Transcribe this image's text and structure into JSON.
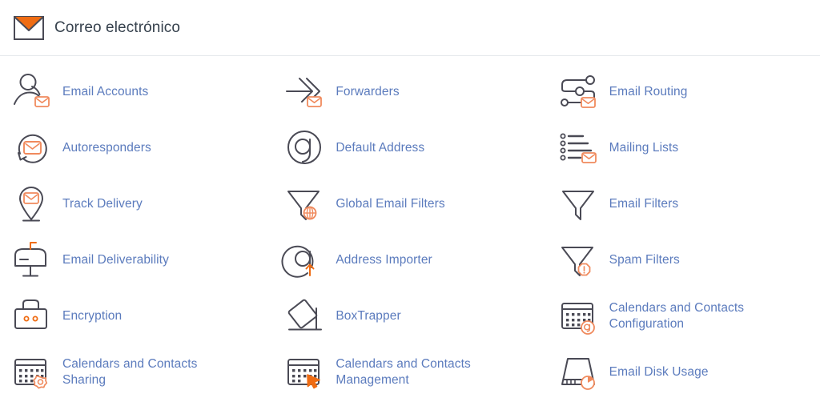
{
  "header": {
    "title": "Correo electrónico",
    "icon": "envelope-icon"
  },
  "colors": {
    "link": "#5b7bbd",
    "accent_orange": "#ef6c13",
    "badge_orange": "#f08a5d",
    "stroke_dark": "#4a4a55",
    "divider": "#e6e9ec",
    "title_text": "#36414d"
  },
  "items": [
    {
      "label": "Email Accounts",
      "icon": "user-envelope-icon",
      "lines": [
        "Email Accounts"
      ]
    },
    {
      "label": "Forwarders",
      "icon": "arrow-forward-envelope-icon",
      "lines": [
        "Forwarders"
      ]
    },
    {
      "label": "Email Routing",
      "icon": "routing-nodes-envelope-icon",
      "lines": [
        "Email Routing"
      ]
    },
    {
      "label": "Autoresponders",
      "icon": "circular-arrow-envelope-icon",
      "lines": [
        "Autoresponders"
      ]
    },
    {
      "label": "Default Address",
      "icon": "at-sign-icon",
      "lines": [
        "Default Address"
      ]
    },
    {
      "label": "Mailing Lists",
      "icon": "list-envelope-icon",
      "lines": [
        "Mailing Lists"
      ]
    },
    {
      "label": "Track Delivery",
      "icon": "map-pin-envelope-icon",
      "lines": [
        "Track Delivery"
      ]
    },
    {
      "label": "Global Email Filters",
      "icon": "funnel-globe-icon",
      "lines": [
        "Global Email Filters"
      ]
    },
    {
      "label": "Email Filters",
      "icon": "funnel-icon",
      "lines": [
        "Email Filters"
      ]
    },
    {
      "label": "Email Deliverability",
      "icon": "mailbox-flag-icon",
      "lines": [
        "Email Deliverability"
      ]
    },
    {
      "label": "Address Importer",
      "icon": "at-sign-upload-icon",
      "lines": [
        "Address Importer"
      ]
    },
    {
      "label": "Spam Filters",
      "icon": "funnel-warning-icon",
      "lines": [
        "Spam Filters"
      ]
    },
    {
      "label": "Encryption",
      "icon": "padlock-icon",
      "lines": [
        "Encryption"
      ]
    },
    {
      "label": "BoxTrapper",
      "icon": "box-trap-icon",
      "lines": [
        "BoxTrapper"
      ]
    },
    {
      "label": "Calendars and Contacts Configuration",
      "icon": "calendar-at-sign-icon",
      "lines": [
        "Calendars and Contacts",
        "Configuration"
      ]
    },
    {
      "label": "Calendars and Contacts Sharing",
      "icon": "calendar-gear-icon",
      "lines": [
        "Calendars and Contacts",
        "Sharing"
      ]
    },
    {
      "label": "Calendars and Contacts Management",
      "icon": "calendar-cursor-icon",
      "lines": [
        "Calendars and Contacts",
        "Management"
      ]
    },
    {
      "label": "Email Disk Usage",
      "icon": "disk-pie-icon",
      "lines": [
        "Email Disk Usage"
      ]
    }
  ]
}
